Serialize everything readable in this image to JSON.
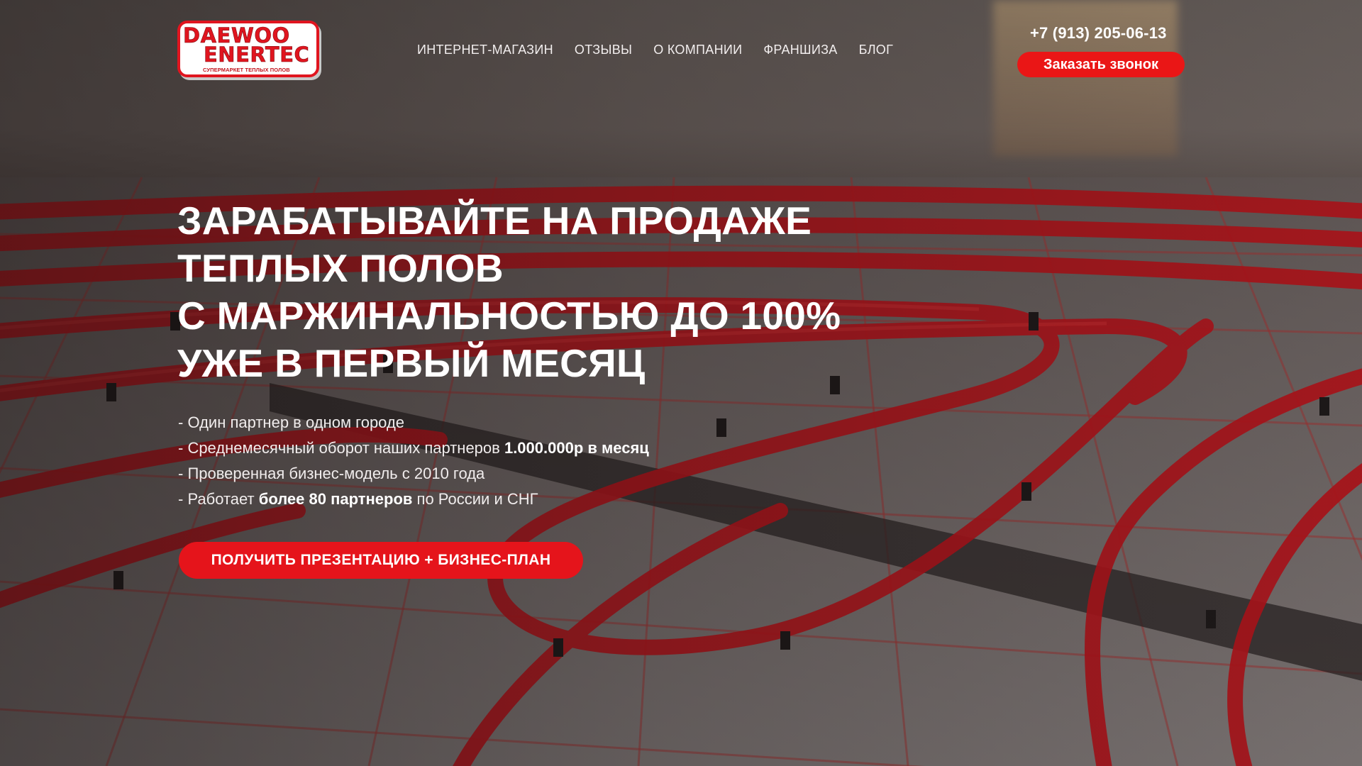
{
  "logo": {
    "line1": "DAEWOO",
    "line2": "ENERTEC",
    "tagline": "СУПЕРМАРКЕТ ТЕПЛЫХ ПОЛОВ"
  },
  "nav": {
    "items": [
      {
        "label": "ИНТЕРНЕТ-МАГАЗИН"
      },
      {
        "label": "ОТЗЫВЫ"
      },
      {
        "label": "О КОМПАНИИ"
      },
      {
        "label": "ФРАНШИЗА"
      },
      {
        "label": "БЛОГ"
      }
    ]
  },
  "contact": {
    "phone": "+7 (913) 205-06-13",
    "callback_label": "Заказать звонок"
  },
  "hero": {
    "headline_lines": [
      "ЗАРАБАТЫВАЙТЕ НА ПРОДАЖЕ",
      "ТЕПЛЫХ ПОЛОВ",
      "С МАРЖИНАЛЬНОСТЬЮ ДО 100%",
      "УЖЕ В ПЕРВЫЙ МЕСЯЦ"
    ],
    "bullets": [
      {
        "text": "- Один партнер в одном городе",
        "bold": "",
        "after": ""
      },
      {
        "text": "- Среднемесячный оборот наших партнеров ",
        "bold": "1.000.000р в месяц",
        "after": ""
      },
      {
        "text": "- Проверенная бизнес-модель с 2010 года",
        "bold": "",
        "after": ""
      },
      {
        "text": "- Работает ",
        "bold": "более 80 партнеров",
        "after": " по России и СНГ"
      }
    ],
    "cta_label": "ПОЛУЧИТЬ ПРЕЗЕНТАЦИЮ + БИЗНЕС-ПЛАН"
  },
  "colors": {
    "accent": "#e5141b",
    "pipe": "#c8141c",
    "text": "#ffffff"
  }
}
